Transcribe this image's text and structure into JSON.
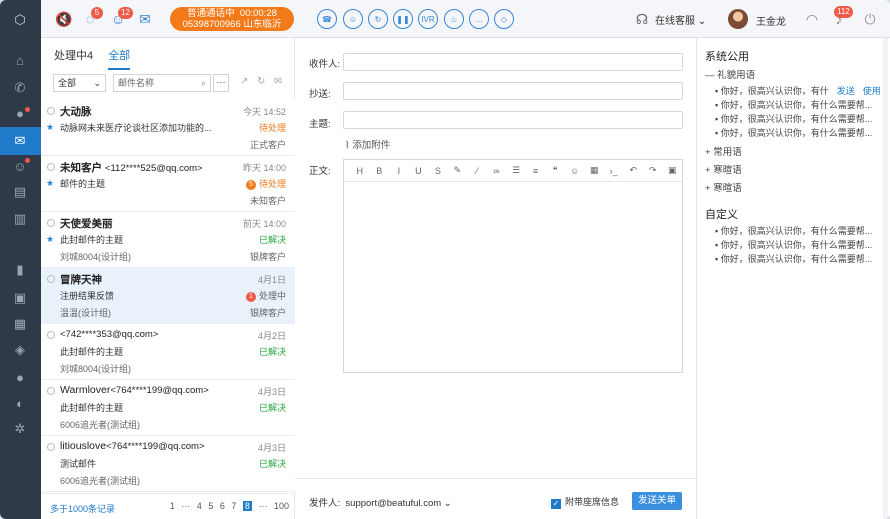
{
  "top": {
    "badges": {
      "chat": "5",
      "visitors": "12",
      "alerts": "112"
    },
    "call_status": "普通通话中",
    "call_time": "00:00:28",
    "call_number": "05398700966",
    "call_location": "山东临沂",
    "ivr_label": "IVR",
    "online_label": "在线客服",
    "user_name": "王金龙"
  },
  "left": {
    "tabs": [
      "处理中4",
      "全部"
    ],
    "filter_value": "全部",
    "search_placeholder": "邮件名称",
    "more_label": "···",
    "items": [
      {
        "name": "大动脉",
        "email": "",
        "time": "今天 14:52",
        "subject": "动脉网未来医疗论谈社区添加功能的...",
        "status": "待处理",
        "status_type": "pend",
        "meta": "",
        "customer": "正式客户",
        "star": true,
        "status_icon": ""
      },
      {
        "name": "未知客户",
        "email": "<112****525@qq.com>",
        "time": "昨天 14:00",
        "subject": "邮件的主题",
        "status": "待处理",
        "status_type": "pend",
        "meta": "",
        "customer": "未知客户",
        "star": true,
        "status_icon": "5"
      },
      {
        "name": "天使爱美丽",
        "email": "",
        "time": "前天 14:00",
        "subject": "此封邮件的主题",
        "status": "已解决",
        "status_type": "done",
        "meta": "刘城8004(设计组)",
        "customer": "银牌客户",
        "star": true,
        "status_icon": ""
      },
      {
        "name": "冒牌天神",
        "email": "",
        "time": "4月1日",
        "subject": "注册结果反馈",
        "status": "处理中",
        "status_type": "proc",
        "meta": "温温(设计组)",
        "customer": "银牌客户",
        "star": false,
        "status_icon": "1"
      },
      {
        "name": "",
        "email": "<742****353@qq.com>",
        "time": "4月2日",
        "subject": "此封邮件的主题",
        "status": "已解决",
        "status_type": "done",
        "meta": "刘城8004(设计组)",
        "customer": "",
        "star": false,
        "status_icon": ""
      },
      {
        "name": "Warmlover",
        "email": "<764****199@qq.com>",
        "time": "4月3日",
        "subject": "此封邮件的主题",
        "status": "已解决",
        "status_type": "done",
        "meta": "6006追光者(测试组)",
        "customer": "",
        "star": false,
        "status_icon": ""
      },
      {
        "name": "litiouslove",
        "email": "<764****199@qq.com>",
        "time": "4月3日",
        "subject": "测试邮件",
        "status": "已解决",
        "status_type": "done",
        "meta": "6006追光者(测试组)",
        "customer": "",
        "star": false,
        "status_icon": ""
      }
    ],
    "records": "多于1000条记录",
    "pager": [
      "1",
      "···",
      "4",
      "5",
      "6",
      "7",
      "8",
      "···",
      "100"
    ],
    "current_page": "8"
  },
  "compose": {
    "to_label": "收件人:",
    "cc_label": "抄送:",
    "subject_label": "主题:",
    "attach_label": "添加附件",
    "body_label": "正文:",
    "sender_label": "发件人:",
    "sender_value": "support@beatuful.com",
    "seat_info": "附带座席信息",
    "send_label": "发送关单"
  },
  "phrases": {
    "public_title": "系统公用",
    "polite_group": "礼貌用语",
    "send_label": "发送",
    "use_label": "使用",
    "polite_items": [
      "你好，很高兴认识你，有什",
      "你好，很高兴认识你，有什么需要帮...",
      "你好，很高兴认识你，有什么需要帮...",
      "你好，很高兴认识你，有什么需要帮..."
    ],
    "groups": [
      "常用语",
      "寒暄语",
      "寒暄语"
    ],
    "custom_title": "自定义",
    "custom_items": [
      "你好，很高兴认识你，有什么需要帮...",
      "你好，很高兴认识你，有什么需要帮...",
      "你好，很高兴认识你，有什么需要帮..."
    ]
  },
  "colors": {
    "accent": "#1f7ac9",
    "call": "#f27a1a",
    "rail": "#2e3a48",
    "pending": "#f27a1a",
    "resolved": "#2aa53b"
  }
}
